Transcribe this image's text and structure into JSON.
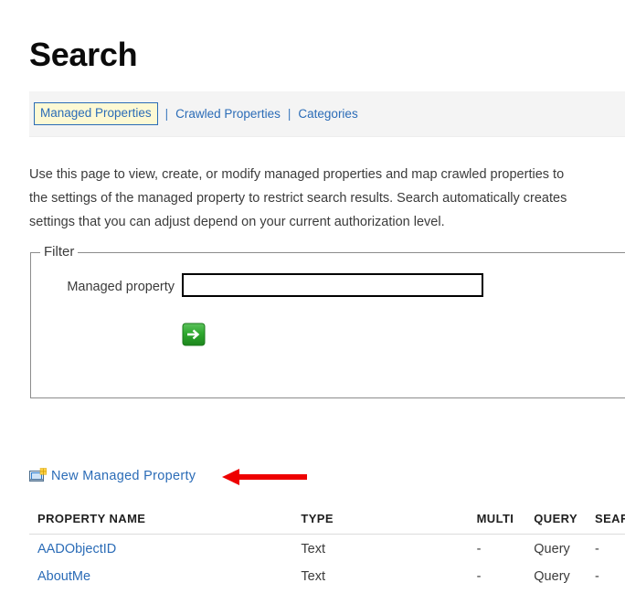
{
  "page": {
    "title": "Search"
  },
  "tabs": [
    {
      "label": "Managed Properties",
      "selected": true
    },
    {
      "label": "Crawled Properties",
      "selected": false
    },
    {
      "label": "Categories",
      "selected": false
    }
  ],
  "tab_separator": "|",
  "description": {
    "line1": "Use this page to view, create, or modify managed properties and map crawled properties to",
    "line2": "the settings of the managed property to restrict search results. Search automatically creates",
    "line3": "settings that you can adjust depend on your current authorization level."
  },
  "filter": {
    "legend": "Filter",
    "label": "Managed property",
    "value": "",
    "placeholder": "",
    "submit_icon": "green-arrow-right-icon"
  },
  "actions": {
    "new_managed_property": "New Managed Property",
    "new_managed_property_icon": "new-item-icon"
  },
  "annotation": {
    "arrow_color": "#ee0000",
    "direction": "left"
  },
  "table": {
    "headers": [
      "PROPERTY NAME",
      "TYPE",
      "MULTI",
      "QUERY",
      "SEARC"
    ],
    "rows": [
      {
        "name": "AADObjectID",
        "type": "Text",
        "multi": "-",
        "query": "Query",
        "search": "-"
      },
      {
        "name": "AboutMe",
        "type": "Text",
        "multi": "-",
        "query": "Query",
        "search": "-"
      }
    ]
  },
  "colors": {
    "link": "#2b6cb7",
    "tab_selected_bg": "#fdf9d4",
    "tabstrip_bg": "#f4f4f4",
    "accent_green": "#2ea62e",
    "annotation_red": "#ee0000"
  }
}
